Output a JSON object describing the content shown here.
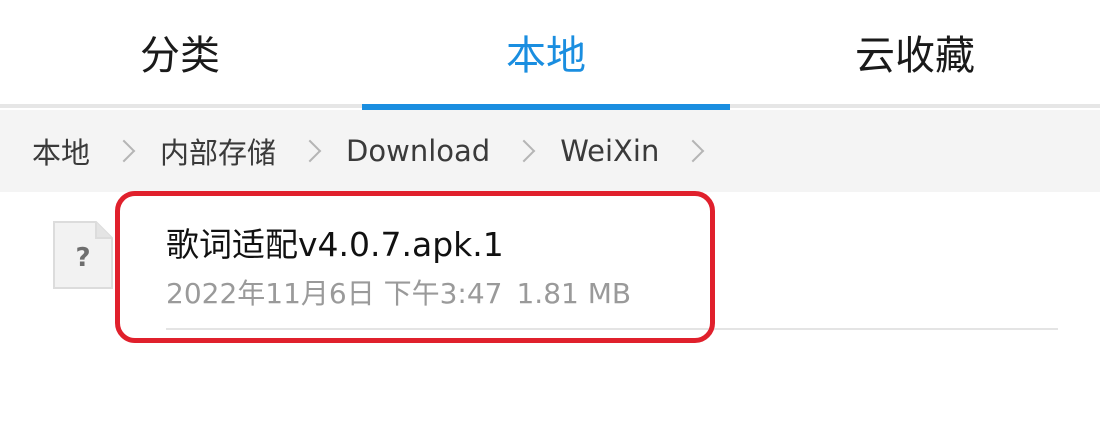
{
  "tabs": [
    {
      "label": "分类",
      "active": false
    },
    {
      "label": "本地",
      "active": true
    },
    {
      "label": "云收藏",
      "active": false
    }
  ],
  "breadcrumb": [
    "本地",
    "内部存储",
    "Download",
    "WeiXin"
  ],
  "files": [
    {
      "name": "歌词适配v4.0.7.apk.1",
      "date": "2022年11月6日 下午3:47",
      "size": "1.81 MB",
      "icon": "unknown-file-icon",
      "icon_glyph": "?"
    }
  ],
  "colors": {
    "accent": "#1a8ee0",
    "highlight": "#e0202c"
  }
}
